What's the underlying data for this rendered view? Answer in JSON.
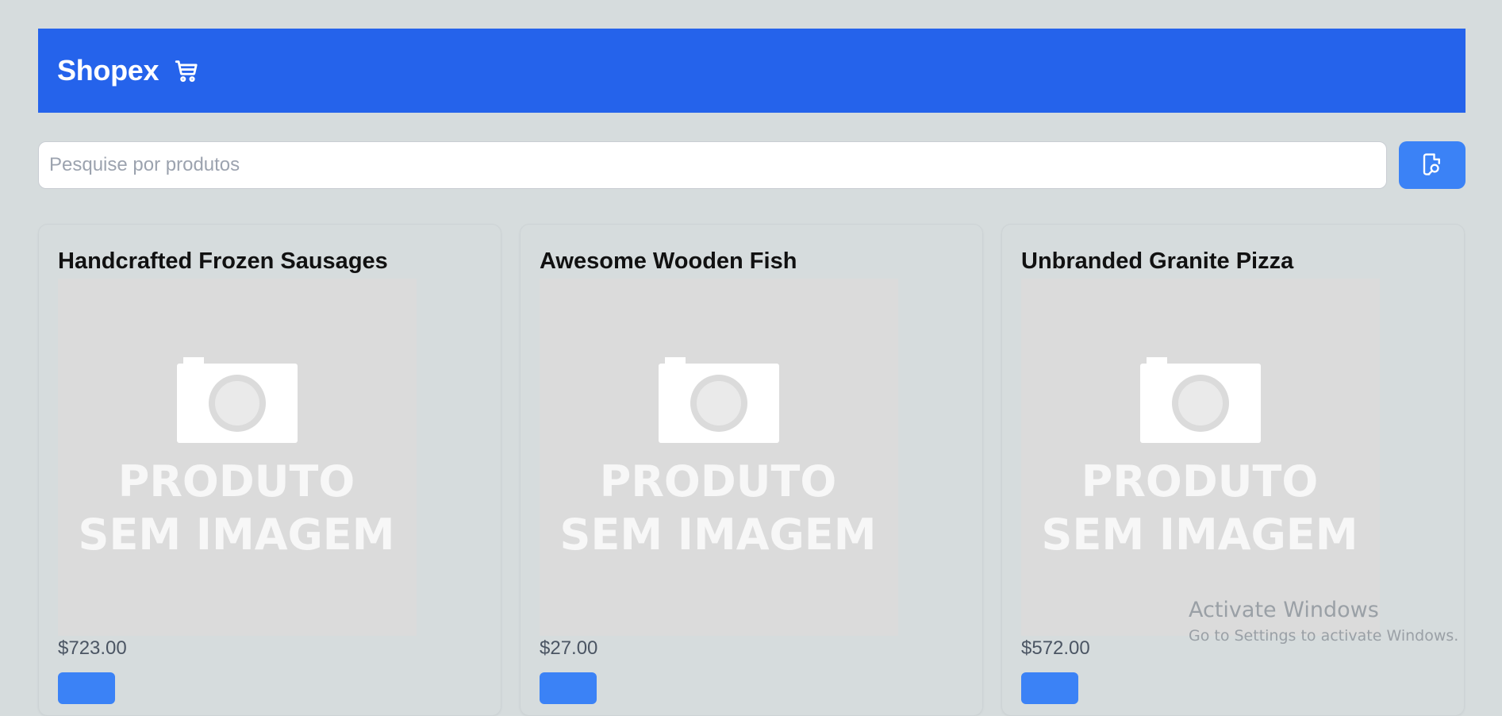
{
  "header": {
    "brand": "Shopex",
    "icon": "cart-icon"
  },
  "search": {
    "placeholder": "Pesquise por produtos",
    "value": "",
    "button_icon": "search-document-icon"
  },
  "products": [
    {
      "name": "Handcrafted Frozen Sausages",
      "price": "$723.00",
      "image_text_line1": "PRODUTO",
      "image_text_line2": "SEM IMAGEM"
    },
    {
      "name": "Awesome Wooden Fish",
      "price": "$27.00",
      "image_text_line1": "PRODUTO",
      "image_text_line2": "SEM IMAGEM"
    },
    {
      "name": "Unbranded Granite Pizza",
      "price": "$572.00",
      "image_text_line1": "PRODUTO",
      "image_text_line2": "SEM IMAGEM"
    }
  ],
  "watermark": {
    "title": "Activate Windows",
    "subtitle": "Go to Settings to activate Windows."
  },
  "colors": {
    "header_bg": "#2563eb",
    "button_bg": "#3b82f6",
    "page_bg": "#d6dcdd"
  }
}
